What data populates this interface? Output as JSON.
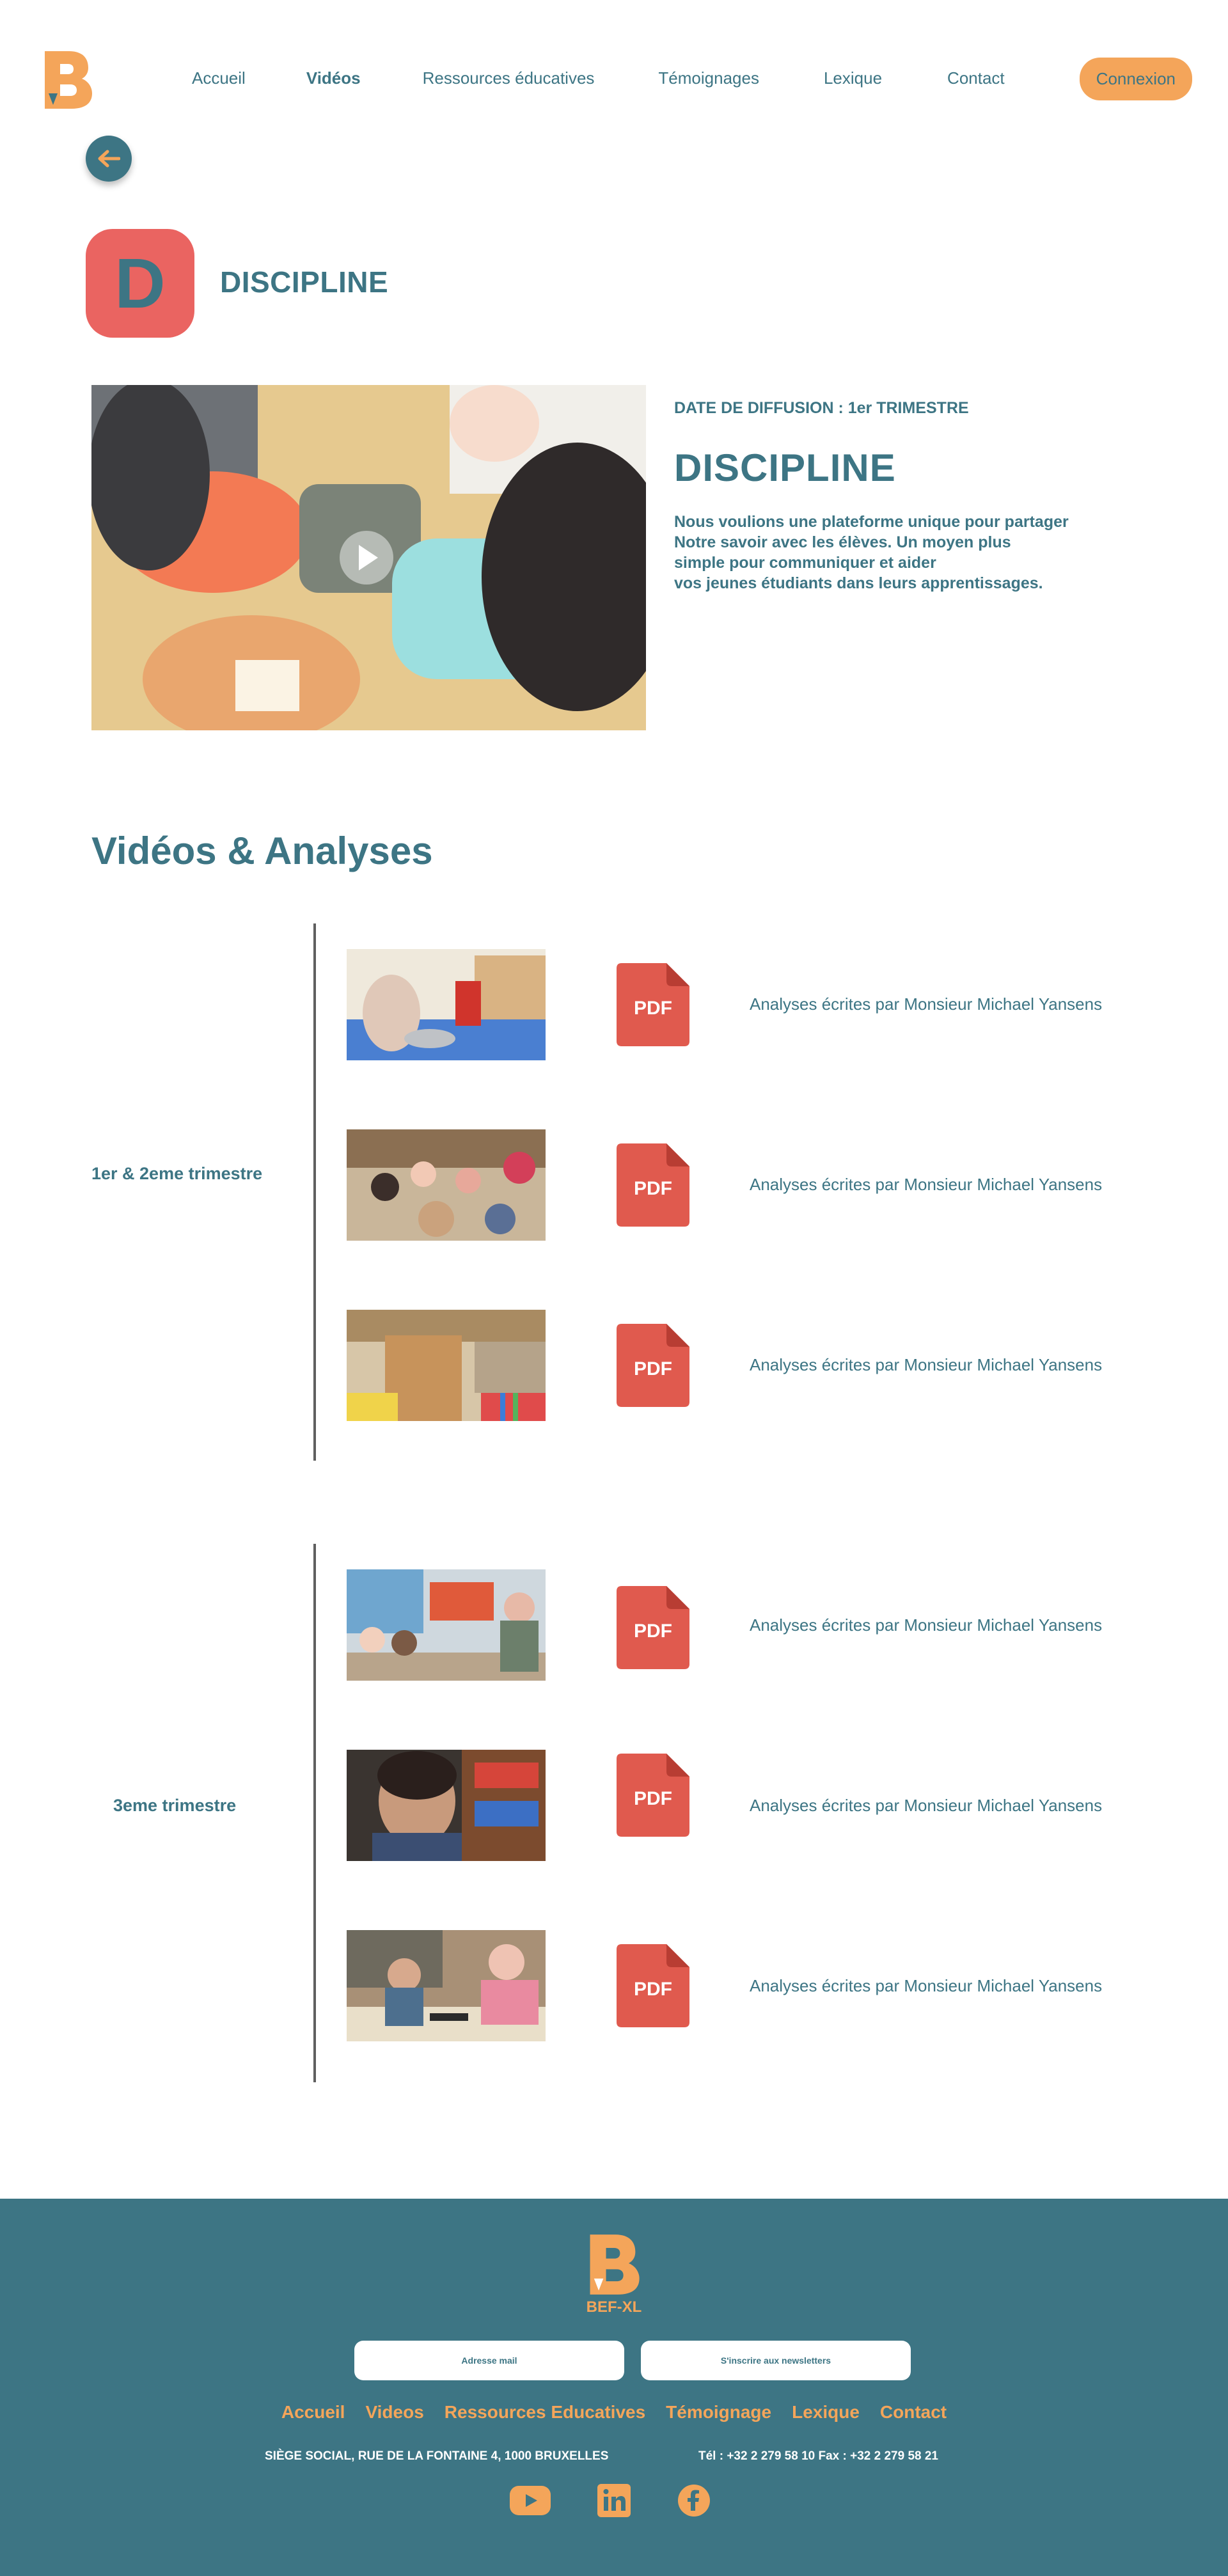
{
  "colors": {
    "teal": "#3d7584",
    "orange": "#f4a55a",
    "red": "#ea6461",
    "divider": "#5f5f5f"
  },
  "header": {
    "logo_icon": "bef-xl-logo",
    "nav": [
      {
        "label": "Accueil",
        "active": false
      },
      {
        "label": "Vidéos",
        "active": true
      },
      {
        "label": "Ressources éducatives",
        "active": false
      },
      {
        "label": "Témoignages",
        "active": false
      },
      {
        "label": "Lexique",
        "active": false
      },
      {
        "label": "Contact",
        "active": false
      }
    ],
    "login_label": "Connexion"
  },
  "back_icon": "arrow-left-icon",
  "category": {
    "letter": "D",
    "title": "DISCIPLINE"
  },
  "hero": {
    "diffusion": "DATE DE DIFFUSION : 1er TRIMESTRE",
    "title": "DISCIPLINE",
    "description": "Nous voulions une plateforme unique pour partager\nNotre savoir avec les élèves. Un moyen plus\nsimple pour communiquer et aider\nvos jeunes étudiants dans leurs apprentissages.",
    "play_icon": "play-icon"
  },
  "videos_section": {
    "title": "Vidéos & Analyses",
    "groups": [
      {
        "label": "1er & 2eme trimestre",
        "items": [
          {
            "thumb": "classroom-thumbnail",
            "pdf_label": "PDF",
            "analysis": "Analyses écrites par Monsieur Michael Yansens"
          },
          {
            "thumb": "classroom-thumbnail",
            "pdf_label": "PDF",
            "analysis": "Analyses écrites par Monsieur Michael Yansens"
          },
          {
            "thumb": "classroom-thumbnail",
            "pdf_label": "PDF",
            "analysis": "Analyses écrites par Monsieur Michael Yansens"
          }
        ]
      },
      {
        "label": "3eme trimestre",
        "items": [
          {
            "thumb": "classroom-thumbnail",
            "pdf_label": "PDF",
            "analysis": "Analyses écrites par Monsieur Michael Yansens"
          },
          {
            "thumb": "classroom-thumbnail",
            "pdf_label": "PDF",
            "analysis": "Analyses écrites par Monsieur Michael Yansens"
          },
          {
            "thumb": "classroom-thumbnail",
            "pdf_label": "PDF",
            "analysis": "Analyses écrites par Monsieur Michael Yansens"
          }
        ]
      }
    ]
  },
  "footer": {
    "brand": "BEF-XL",
    "email_placeholder": "Adresse mail",
    "newsletter_label": "S'inscrire aux newsletters",
    "nav": [
      "Accueil",
      "Videos",
      "Ressources Educatives",
      "Témoignage",
      "Lexique",
      "Contact"
    ],
    "address": "SIÈGE SOCIAL, RUE DE LA FONTAINE 4, 1000 BRUXELLES",
    "phone": "Tél : +32 2 279 58 10 Fax : +32 2 279 58 21",
    "social": [
      "youtube-icon",
      "linkedin-icon",
      "facebook-icon"
    ]
  }
}
